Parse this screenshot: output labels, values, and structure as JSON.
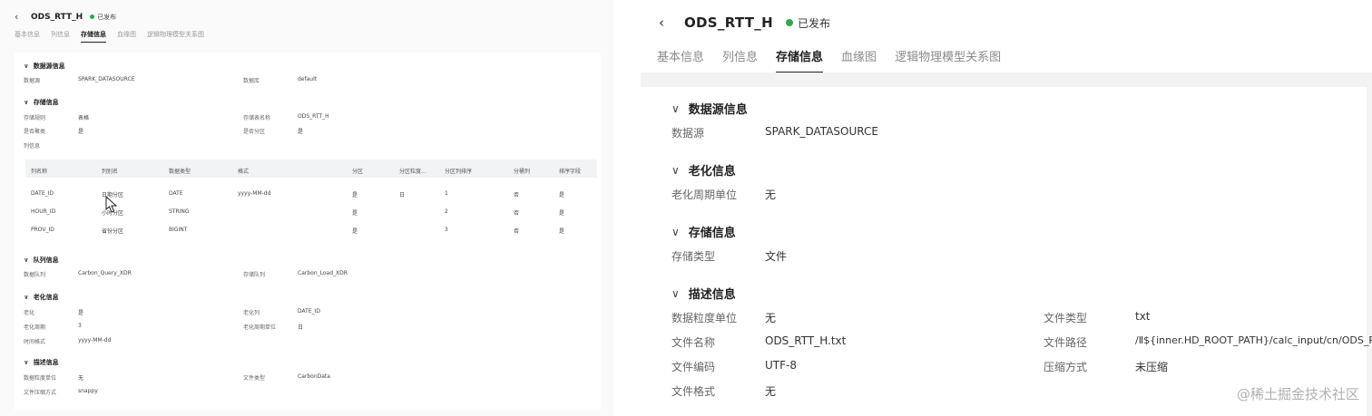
{
  "left_panel": {
    "title": "ODS_RTT_H",
    "status": "已发布",
    "tabs": [
      "基本信息",
      "列信息",
      "存储信息",
      "血缘图",
      "逻辑物理模型关系图"
    ],
    "datasource": {
      "section": "数据源信息",
      "label": "数据源",
      "value": "SPARK_DATASOURCE",
      "label2": "数据库",
      "value2": "default"
    },
    "storage": {
      "section": "存储信息",
      "rule_label": "存储规则",
      "rule_value": "表格",
      "table_label": "存储表名称",
      "table_value": "ODS_RTT_H",
      "cluster_label": "是否聚类",
      "cluster_value": "是",
      "partition_label": "是否分区",
      "partition_value": "是",
      "columns_label": "列信息"
    },
    "table": {
      "headers": [
        "列名称",
        "列别名",
        "数据类型",
        "格式",
        "分区",
        "分区粒度...",
        "分区列排序",
        "分桶列",
        "排序字段"
      ],
      "rows": [
        [
          "DATE_ID",
          "日期分区",
          "DATE",
          "yyyy-MM-dd",
          "是",
          "日",
          "1",
          "否",
          "是"
        ],
        [
          "HOUR_ID",
          "小时分区",
          "STRING",
          "",
          "是",
          "",
          "2",
          "否",
          "是"
        ],
        [
          "PROV_ID",
          "省份分区",
          "BIGINT",
          "",
          "是",
          "",
          "3",
          "否",
          "是"
        ]
      ]
    },
    "queue": {
      "section": "队列信息",
      "label": "数据队列",
      "value": "Carbon_Query_XDR",
      "label2": "存储队列",
      "value2": "Carbon_Load_XDR"
    },
    "aging": {
      "section": "老化信息",
      "aging_label": "老化",
      "aging_value": "是",
      "col_label": "老化列",
      "col_value": "DATE_ID",
      "period_label": "老化周期",
      "period_value": "3",
      "unit_label": "老化周期单位",
      "unit_value": "日",
      "format_label": "时间格式",
      "format_value": "yyyy-MM-dd"
    },
    "desc": {
      "section": "描述信息",
      "gran_label": "数据粒度单位",
      "gran_value": "无",
      "ftype_label": "文件类型",
      "ftype_value": "CarbonData",
      "compress_label": "文件压缩方式",
      "compress_value": "snappy"
    }
  },
  "right_panel": {
    "title": "ODS_RTT_H",
    "status": "已发布",
    "tabs": [
      "基本信息",
      "列信息",
      "存储信息",
      "血缘图",
      "逻辑物理模型关系图"
    ],
    "datasource": {
      "section": "数据源信息",
      "label": "数据源",
      "value": "SPARK_DATASOURCE"
    },
    "aging": {
      "section": "老化信息",
      "label": "老化周期单位",
      "value": "无"
    },
    "storage": {
      "section": "存储信息",
      "label": "存储类型",
      "value": "文件"
    },
    "desc": {
      "section": "描述信息",
      "gran_label": "数据粒度单位",
      "gran_value": "无",
      "ftype_label": "文件类型",
      "ftype_value": "txt",
      "fname_label": "文件名称",
      "fname_value": "ODS_RTT_H.txt",
      "fpath_label": "文件路径",
      "fpath_value": "/Ⅱ${inner.HD_ROOT_PATH}/calc_input/cn/ODS_RT...",
      "fenc_label": "文件编码",
      "fenc_value": "UTF-8",
      "compress_label": "压缩方式",
      "compress_value": "未压缩",
      "fformat_label": "文件格式",
      "fformat_value": "无"
    }
  },
  "watermark": "@稀土掘金技术社区",
  "colors": {
    "published_dot": "#2fa84f",
    "header_bar": "#f2f3f5"
  }
}
